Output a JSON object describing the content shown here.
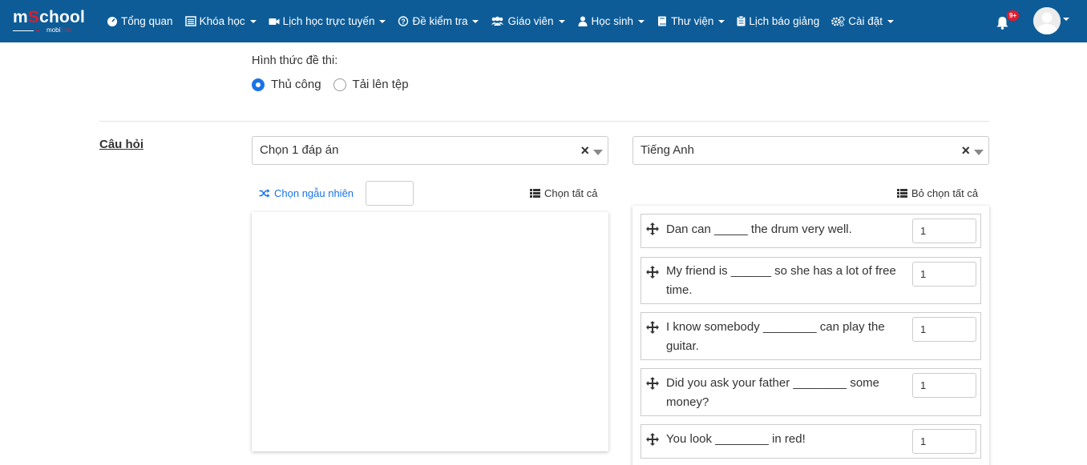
{
  "navbar": {
    "logo_text_main_prefix": "m",
    "logo_text_main_o": "S",
    "logo_text_main_suffix": "chool",
    "logo_sub_white": "mobi",
    "logo_sub_red": "Edu",
    "items": [
      {
        "label": "Tổng quan",
        "icon": "dashboard-icon",
        "dropdown": false
      },
      {
        "label": "Khóa học",
        "icon": "list-icon",
        "dropdown": true
      },
      {
        "label": "Lịch học trực tuyến",
        "icon": "video-icon",
        "dropdown": true
      },
      {
        "label": "Đề kiểm tra",
        "icon": "question-circle-icon",
        "dropdown": true
      },
      {
        "label": "Giáo viên",
        "icon": "users-icon",
        "dropdown": true
      },
      {
        "label": "Học sinh",
        "icon": "user-icon",
        "dropdown": true
      },
      {
        "label": "Thư viện",
        "icon": "book-icon",
        "dropdown": true
      },
      {
        "label": "Lịch báo giảng",
        "icon": "clipboard-icon",
        "dropdown": false
      },
      {
        "label": "Cài đặt",
        "icon": "cogs-icon",
        "dropdown": true
      }
    ],
    "notification_badge": "9+"
  },
  "form": {
    "format_label": "Hình thức đề thi:",
    "radio_options": [
      {
        "label": "Thủ công",
        "checked": true
      },
      {
        "label": "Tải lên tệp",
        "checked": false
      }
    ]
  },
  "questions_section": {
    "title": "Câu hỏi",
    "type_select_value": "Chọn 1 đáp án",
    "subject_select_value": "Tiếng Anh",
    "random_label": "Chọn ngẫu nhiên",
    "random_count_value": "",
    "select_all_label": "Chọn tất cả",
    "deselect_all_label": "Bỏ chọn tất cả",
    "selected_questions": [
      {
        "text": "Dan can _____ the drum very well.",
        "score": "1"
      },
      {
        "text": "My friend is ______ so she has a lot of free time.",
        "score": "1"
      },
      {
        "text": "I know somebody ________ can play the guitar.",
        "score": "1"
      },
      {
        "text": "Did you ask your father ________ some money?",
        "score": "1"
      },
      {
        "text": "You look ________ in red!",
        "score": "1"
      }
    ]
  },
  "colors": {
    "navbar_bg": "#0d5c97",
    "accent_blue": "#1a73e8",
    "brand_red": "#e21b2c"
  }
}
